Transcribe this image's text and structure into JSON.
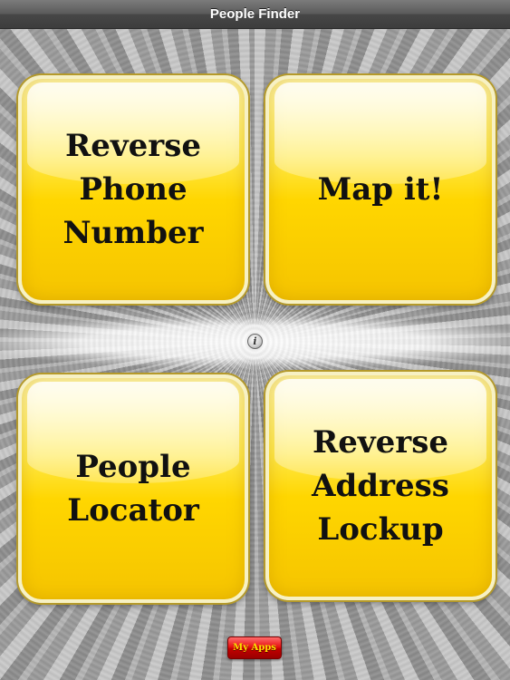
{
  "app": {
    "title": "People Finder"
  },
  "tiles": [
    {
      "id": "reverse-phone",
      "label": "Reverse\nPhone\nNumber"
    },
    {
      "id": "map-it",
      "label": "Map it!"
    },
    {
      "id": "people-locator",
      "label": "People\nLocator"
    },
    {
      "id": "reverse-address",
      "label": "Reverse\nAddress\nLockup"
    }
  ],
  "info_button": {
    "glyph": "i",
    "icon": "info-icon"
  },
  "footer": {
    "my_apps_label": "My Apps"
  },
  "colors": {
    "tile_yellow": "#ffd600",
    "tile_border": "#f7f1c4",
    "titlebar": "#4a4a4a",
    "my_apps_red": "#e81313",
    "my_apps_text": "#ffe000"
  }
}
